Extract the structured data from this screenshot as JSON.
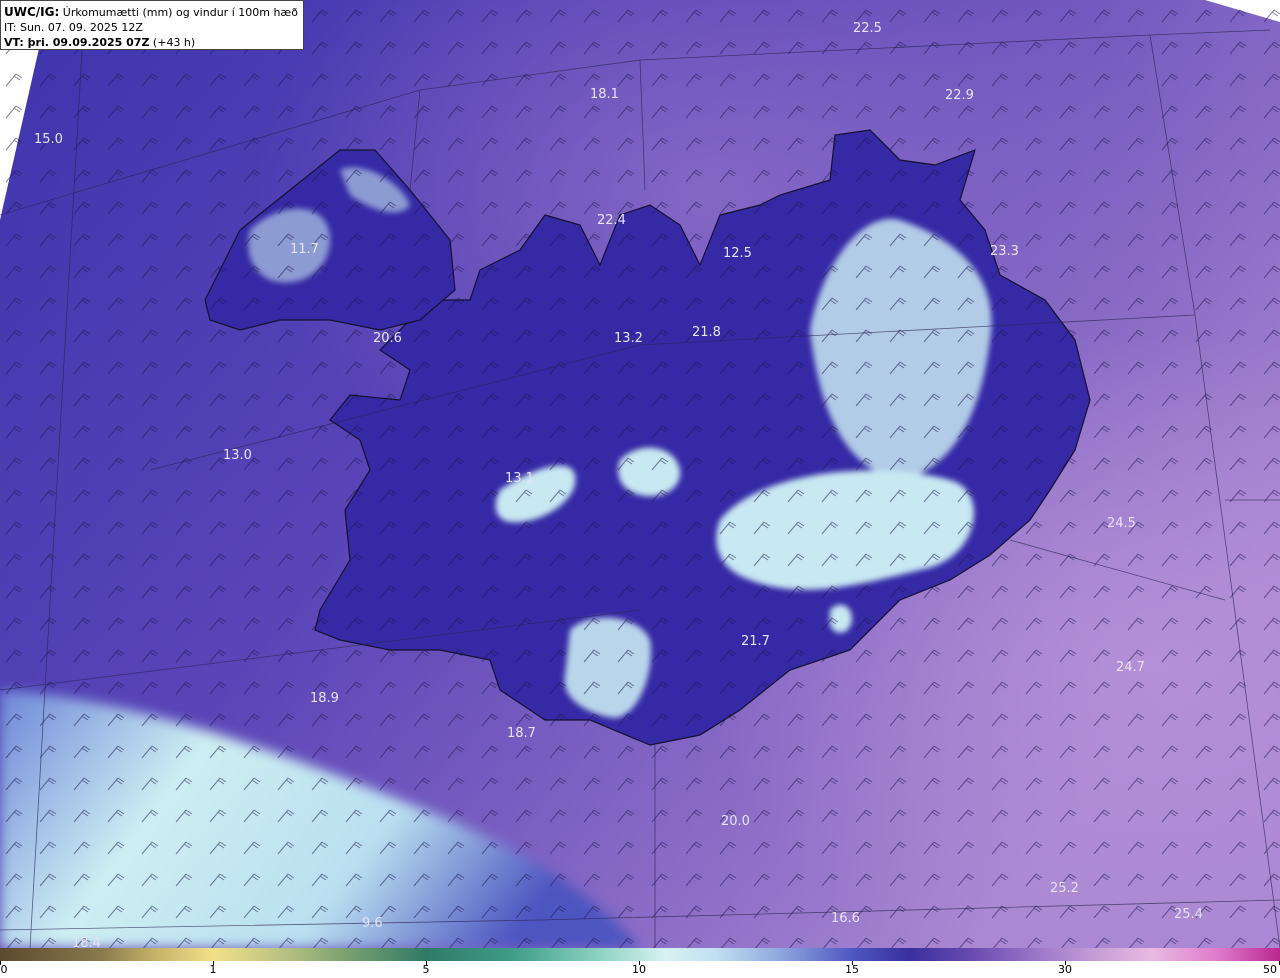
{
  "header": {
    "model": "UWC/IG:",
    "title": " Úrkomumætti (mm) og vindur í 100m hæð",
    "init_time": "IT: Sun. 07. 09. 2025 12Z",
    "valid_prefix": "VT: ",
    "valid_time": "þri. 09.09.2025 07Z",
    "lead_time": " (+43 h)"
  },
  "field_labels": [
    {
      "id": "p1",
      "value": "22.5"
    },
    {
      "id": "p2",
      "value": "18.1"
    },
    {
      "id": "p3",
      "value": "22.9"
    },
    {
      "id": "p4",
      "value": "15.0"
    },
    {
      "id": "p5",
      "value": "22.4"
    },
    {
      "id": "p6",
      "value": "11.7"
    },
    {
      "id": "p7",
      "value": "12.5"
    },
    {
      "id": "p8",
      "value": "23.3"
    },
    {
      "id": "p9",
      "value": "20.6"
    },
    {
      "id": "p10",
      "value": "13.2"
    },
    {
      "id": "p11",
      "value": "21.8"
    },
    {
      "id": "p12",
      "value": "13.0"
    },
    {
      "id": "p13",
      "value": "13.1"
    },
    {
      "id": "p14",
      "value": "24.5"
    },
    {
      "id": "p15",
      "value": "21.7"
    },
    {
      "id": "p16",
      "value": "24.7"
    },
    {
      "id": "p17",
      "value": "18.9"
    },
    {
      "id": "p18",
      "value": "18.7"
    },
    {
      "id": "p19",
      "value": "20.0"
    },
    {
      "id": "p20",
      "value": "25.2"
    },
    {
      "id": "p21",
      "value": "16.6"
    },
    {
      "id": "p22",
      "value": "25.4"
    },
    {
      "id": "p23",
      "value": "9.6"
    },
    {
      "id": "p24",
      "value": "18.4"
    }
  ],
  "colorbar": {
    "ticks": [
      "0",
      "1",
      "5",
      "10",
      "15",
      "30",
      "50"
    ],
    "colors": {
      "low": "#5a4a2e",
      "one": "#f2e089",
      "five": "#2f7a66",
      "ten": "#d8f1f2",
      "fifteen": "#3a2f9e",
      "thirty": "#e9b9e3",
      "fifty": "#b8288f"
    }
  },
  "colors": {
    "ocean": "#4a3fb3",
    "ocean_east": "#8c6cc4",
    "land_dark": "#3428a8",
    "heavy_precip": "#d6f2f3",
    "coast": "#1a1a2a"
  }
}
